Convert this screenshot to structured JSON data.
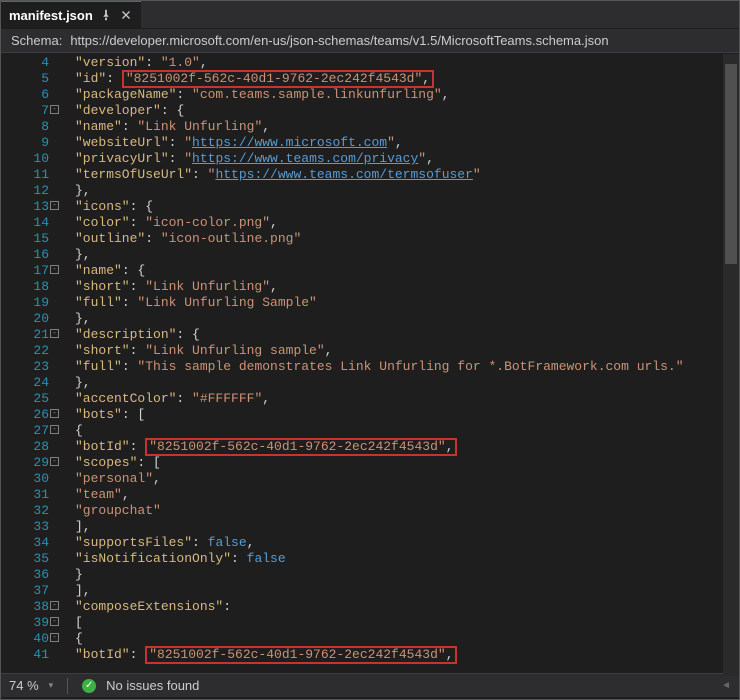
{
  "tab": {
    "title": "manifest.json"
  },
  "schema": {
    "label": "Schema:",
    "url": "https://developer.microsoft.com/en-us/json-schemas/teams/v1.5/MicrosoftTeams.schema.json"
  },
  "code": {
    "lines": [
      {
        "num": 4,
        "indent": 2,
        "key": "version",
        "val": "1.0",
        "comma": true
      },
      {
        "num": 5,
        "indent": 2,
        "key": "id",
        "highlight": true,
        "val": "8251002f-562c-40d1-9762-2ec242f4543d",
        "comma": true
      },
      {
        "num": 6,
        "indent": 2,
        "key": "packageName",
        "val": "com.teams.sample.linkunfurling",
        "comma": true
      },
      {
        "num": 7,
        "indent": 2,
        "key": "developer",
        "open": "{",
        "fold": true
      },
      {
        "num": 8,
        "indent": 3,
        "key": "name",
        "val": "Link Unfurling",
        "comma": true
      },
      {
        "num": 9,
        "indent": 3,
        "key": "websiteUrl",
        "url": "https://www.microsoft.com",
        "comma": true
      },
      {
        "num": 10,
        "indent": 3,
        "key": "privacyUrl",
        "url": "https://www.teams.com/privacy",
        "comma": true
      },
      {
        "num": 11,
        "indent": 3,
        "key": "termsOfUseUrl",
        "url": "https://www.teams.com/termsofuser"
      },
      {
        "num": 12,
        "indent": 2,
        "close": "},"
      },
      {
        "num": 13,
        "indent": 2,
        "key": "icons",
        "open": "{",
        "fold": true
      },
      {
        "num": 14,
        "indent": 3,
        "key": "color",
        "val": "icon-color.png",
        "comma": true
      },
      {
        "num": 15,
        "indent": 3,
        "key": "outline",
        "val": "icon-outline.png"
      },
      {
        "num": 16,
        "indent": 2,
        "close": "},"
      },
      {
        "num": 17,
        "indent": 2,
        "key": "name",
        "open": "{",
        "fold": true
      },
      {
        "num": 18,
        "indent": 3,
        "key": "short",
        "val": "Link Unfurling",
        "comma": true
      },
      {
        "num": 19,
        "indent": 3,
        "key": "full",
        "val": "Link Unfurling Sample"
      },
      {
        "num": 20,
        "indent": 2,
        "close": "},"
      },
      {
        "num": 21,
        "indent": 2,
        "key": "description",
        "open": "{",
        "fold": true
      },
      {
        "num": 22,
        "indent": 3,
        "key": "short",
        "val": "Link Unfurling sample",
        "comma": true
      },
      {
        "num": 23,
        "indent": 3,
        "key": "full",
        "val": "This sample demonstrates Link Unfurling for *.BotFramework.com urls."
      },
      {
        "num": 24,
        "indent": 2,
        "close": "},"
      },
      {
        "num": 25,
        "indent": 2,
        "key": "accentColor",
        "val": "#FFFFFF",
        "comma": true
      },
      {
        "num": 26,
        "indent": 2,
        "key": "bots",
        "open": "[",
        "fold": true
      },
      {
        "num": 27,
        "indent": 3,
        "open_raw": "{",
        "fold": true
      },
      {
        "num": 28,
        "indent": 4,
        "key": "botId",
        "highlight": true,
        "val": "8251002f-562c-40d1-9762-2ec242f4543d",
        "comma": true
      },
      {
        "num": 29,
        "indent": 4,
        "key": "scopes",
        "open": "[",
        "fold": true
      },
      {
        "num": 30,
        "indent": 5,
        "plain_str": "personal",
        "comma": true
      },
      {
        "num": 31,
        "indent": 5,
        "plain_str": "team",
        "comma": true
      },
      {
        "num": 32,
        "indent": 5,
        "plain_str": "groupchat"
      },
      {
        "num": 33,
        "indent": 4,
        "close": "],"
      },
      {
        "num": 34,
        "indent": 4,
        "key": "supportsFiles",
        "bool": "false",
        "comma": true
      },
      {
        "num": 35,
        "indent": 4,
        "key": "isNotificationOnly",
        "bool": "false"
      },
      {
        "num": 36,
        "indent": 3,
        "close": "}"
      },
      {
        "num": 37,
        "indent": 2,
        "close": "],"
      },
      {
        "num": 38,
        "indent": 2,
        "key": "composeExtensions",
        "open_nl": ":",
        "fold": true
      },
      {
        "num": 39,
        "indent": 2,
        "open_raw": "[",
        "fold": true
      },
      {
        "num": 40,
        "indent": 3,
        "open_raw": "{",
        "fold": true
      },
      {
        "num": 41,
        "indent": 4,
        "key": "botId",
        "highlight": true,
        "val": "8251002f-562c-40d1-9762-2ec242f4543d",
        "comma": true
      }
    ]
  },
  "status": {
    "zoom": "74 %",
    "issues": "No issues found"
  }
}
